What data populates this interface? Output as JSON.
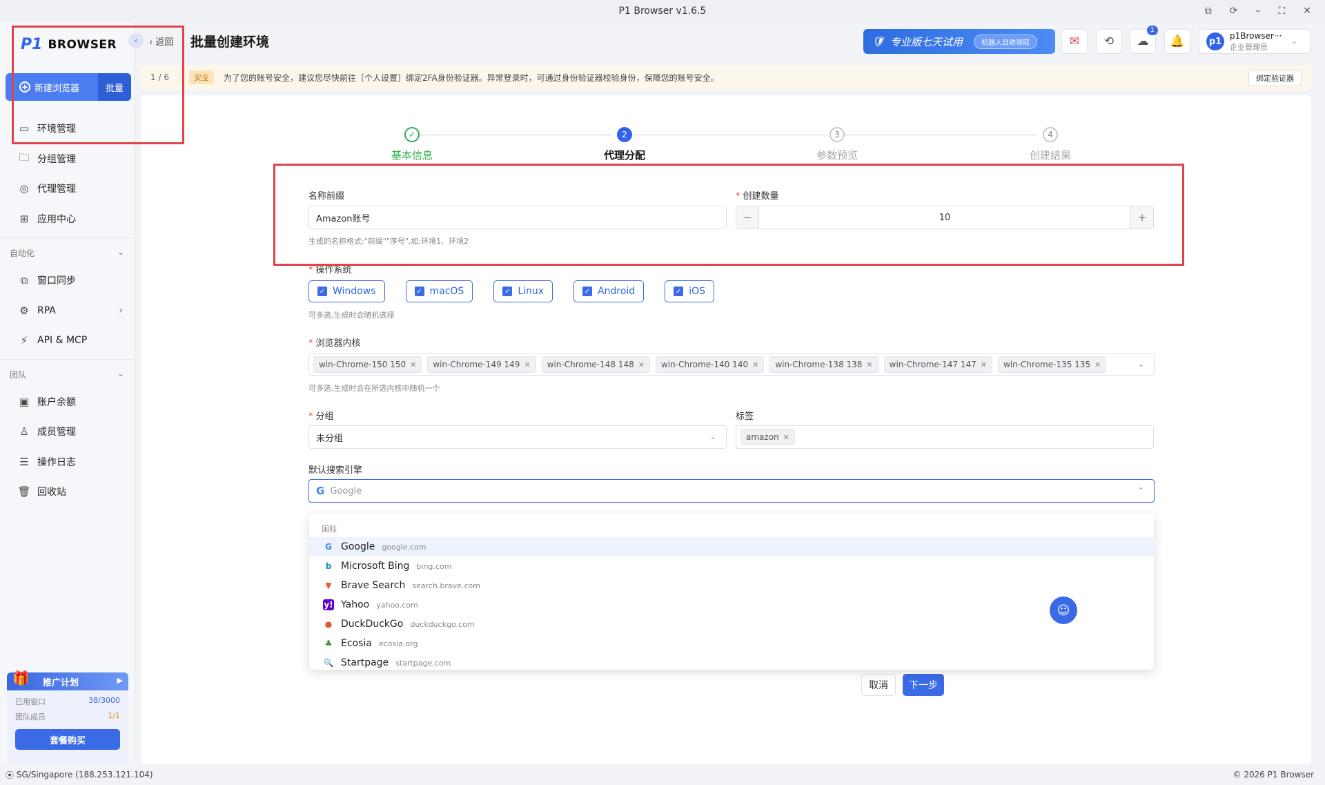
{
  "window": {
    "title": "P1 Browser v1.6.5"
  },
  "sidebar": {
    "logo_mark": "P1",
    "logo_text": "BROWSER",
    "new_browser_label": "新建浏览器",
    "batch_label": "批量",
    "items_main": [
      {
        "label": "环境管理",
        "icon": "browser-window-icon"
      },
      {
        "label": "分组管理",
        "icon": "folder-icon"
      },
      {
        "label": "代理管理",
        "icon": "globe-icon"
      },
      {
        "label": "应用中心",
        "icon": "grid-icon"
      }
    ],
    "section_automation": "自动化",
    "items_automation": [
      {
        "label": "窗口同步",
        "icon": "sync-window-icon"
      },
      {
        "label": "RPA",
        "icon": "robot-icon"
      },
      {
        "label": "API & MCP",
        "icon": "plug-icon"
      }
    ],
    "section_team": "团队",
    "items_team": [
      {
        "label": "账户余额",
        "icon": "wallet-icon"
      },
      {
        "label": "成员管理",
        "icon": "user-icon"
      },
      {
        "label": "操作日志",
        "icon": "log-icon"
      },
      {
        "label": "回收站",
        "icon": "trash-icon"
      }
    ],
    "promo": {
      "title": "推广计划",
      "windows_used_label": "已用窗口",
      "windows_used_value": "38/3000",
      "members_label": "团队成员",
      "members_value": "1/1",
      "buy_label": "套餐购买"
    }
  },
  "header": {
    "back_label": "返回",
    "title": "批量创建环境",
    "trial_text": "专业版七天试用",
    "trial_pill": "机器人自助领取",
    "download_badge": "1",
    "user_name": "p1Browser···",
    "user_role": "企业管理员",
    "avatar_text": "p1"
  },
  "notice": {
    "page": "1 / 6",
    "tag": "安全",
    "message": "为了您的账号安全，建议您尽快前往［个人设置］绑定2FA身份验证器。异常登录时，可通过身份验证器校验身份，保障您的账号安全。",
    "bind_label": "绑定验证器"
  },
  "steps": [
    {
      "label": "基本信息",
      "num": "✓",
      "state": "done"
    },
    {
      "label": "代理分配",
      "num": "2",
      "state": "active"
    },
    {
      "label": "参数预览",
      "num": "3",
      "state": "todo"
    },
    {
      "label": "创建结果",
      "num": "4",
      "state": "todo"
    }
  ],
  "form": {
    "name_prefix_label": "名称前缀",
    "name_prefix_value": "Amazon账号",
    "name_hint": "生成的名称格式:\"前缀\"\"序号\",如:环境1、环境2",
    "count_label": "创建数量",
    "count_value": "10",
    "os_label": "操作系统",
    "os_options": [
      "Windows",
      "macOS",
      "Linux",
      "Android",
      "iOS"
    ],
    "os_hint": "可多选,生成时会随机选择",
    "kernel_label": "浏览器内核",
    "kernels": [
      "win-Chrome-150 150",
      "win-Chrome-149 149",
      "win-Chrome-148 148",
      "win-Chrome-140 140",
      "win-Chrome-138 138",
      "win-Chrome-147 147",
      "win-Chrome-135 135"
    ],
    "kernel_hint": "可多选,生成时会在所选内核中随机一个",
    "group_label": "分组",
    "group_value": "未分组",
    "tag_label": "标签",
    "tags": [
      "amazon"
    ],
    "search_label": "默认搜索引擎",
    "search_value": "Google"
  },
  "dropdown": {
    "group_title": "国际",
    "options": [
      {
        "name": "Google",
        "domain": "google.com",
        "icon": "google-icon",
        "color": "#4285F4"
      },
      {
        "name": "Microsoft Bing",
        "domain": "bing.com",
        "icon": "bing-icon",
        "color": "#1f8bd0"
      },
      {
        "name": "Brave Search",
        "domain": "search.brave.com",
        "icon": "brave-icon",
        "color": "#f1562b"
      },
      {
        "name": "Yahoo",
        "domain": "yahoo.com",
        "icon": "yahoo-icon",
        "color": "#6001d2"
      },
      {
        "name": "DuckDuckGo",
        "domain": "duckduckgo.com",
        "icon": "duckduckgo-icon",
        "color": "#de5833"
      },
      {
        "name": "Ecosia",
        "domain": "ecosia.org",
        "icon": "ecosia-icon",
        "color": "#3a8a32"
      },
      {
        "name": "Startpage",
        "domain": "startpage.com",
        "icon": "startpage-icon",
        "color": "#3b5bdb"
      }
    ]
  },
  "actions": {
    "cancel_label": "取消",
    "next_label": "下一步"
  },
  "status": {
    "location": "SG/Singapore (188.253.121.104)",
    "copyright": "© 2026 P1 Browser"
  },
  "colors": {
    "accent": "#3b6ae6",
    "success": "#2fb04a",
    "highlight": "#e0424a"
  }
}
